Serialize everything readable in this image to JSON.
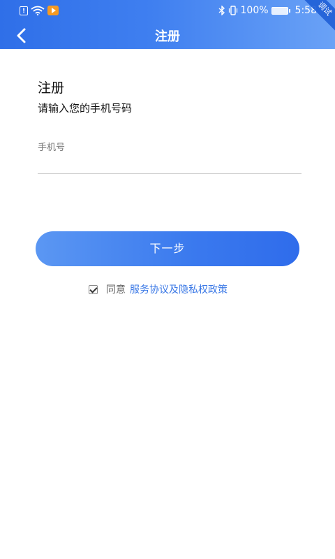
{
  "status_bar": {
    "notif_glyph": "!",
    "battery": "100%",
    "time": "5:58",
    "corner_badge": "调试"
  },
  "nav": {
    "title": "注册"
  },
  "form": {
    "heading": "注册",
    "subheading": "请输入您的手机号码",
    "phone_label": "手机号",
    "phone_value": "",
    "next_button": "下一步",
    "agree_prefix": "同意",
    "policy_link": "服务协议及隐私权政策",
    "agreed": true
  },
  "colors": {
    "brand_blue": "#3a79ee",
    "link_blue": "#3a78e6"
  },
  "icons": [
    "notification-icon",
    "wifi-icon",
    "play-app-icon",
    "bluetooth-icon",
    "vibrate-icon",
    "battery-icon",
    "back-arrow-icon"
  ]
}
